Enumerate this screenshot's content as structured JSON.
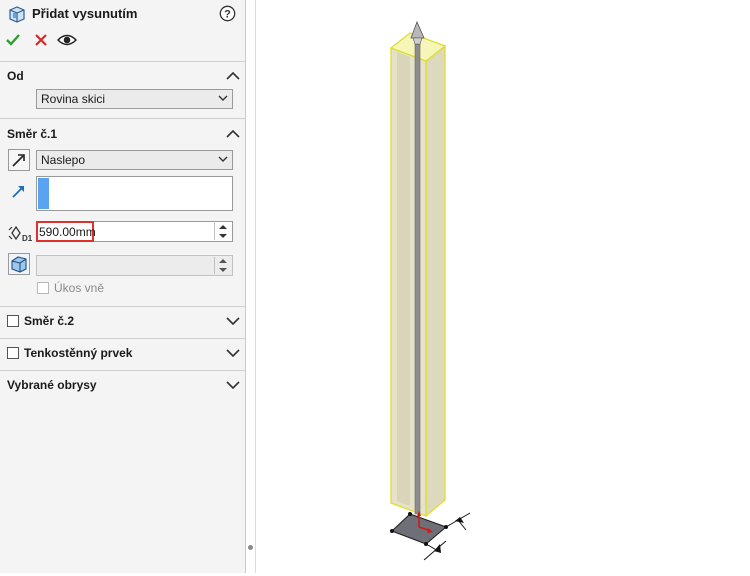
{
  "property_manager": {
    "title": "Přidat vysunutím",
    "help_icon": "help-icon",
    "actions": {
      "ok": "check-icon",
      "cancel": "cross-icon",
      "preview": "eye-icon"
    }
  },
  "from_section": {
    "title": "Od",
    "combo_value": "Rovina skici"
  },
  "direction1": {
    "title": "Směr č.1",
    "end_condition": "Naslepo",
    "depth_value": "590.00mm",
    "draft_checkbox_label": "Úkos vně",
    "icons": [
      "reverse-direction-icon",
      "direction-vector-icon",
      "depth-dimension-icon",
      "draft-icon"
    ]
  },
  "direction2": {
    "title": "Směr č.2",
    "checked": false
  },
  "thin_feature": {
    "title": "Tenkostěnný prvek",
    "checked": false
  },
  "selected_contours": {
    "title": "Vybrané obrysy"
  },
  "colors": {
    "accent_blue": "#5aa3f0",
    "highlight_red": "#e0302c",
    "preview_yellow": "#f3f35a",
    "ok_green": "#2e9e2e",
    "cancel_red": "#d42a2a"
  }
}
